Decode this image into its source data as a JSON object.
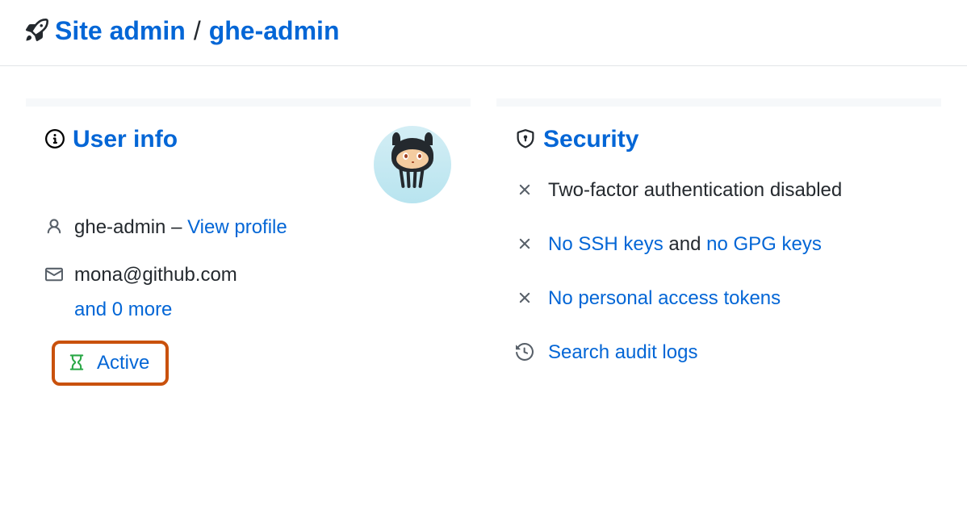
{
  "breadcrumb": {
    "site_admin": "Site admin",
    "separator": "/",
    "user": "ghe-admin"
  },
  "user_info": {
    "title": "User info",
    "username": "ghe-admin",
    "dash": " – ",
    "view_profile": "View profile",
    "email": "mona@github.com",
    "more_emails": "and 0 more",
    "status": "Active"
  },
  "security": {
    "title": "Security",
    "two_factor": "Two-factor authentication disabled",
    "no_ssh": "No SSH keys",
    "and": " and ",
    "no_gpg": "no GPG keys",
    "no_pat": "No personal access tokens",
    "audit": "Search audit logs"
  }
}
